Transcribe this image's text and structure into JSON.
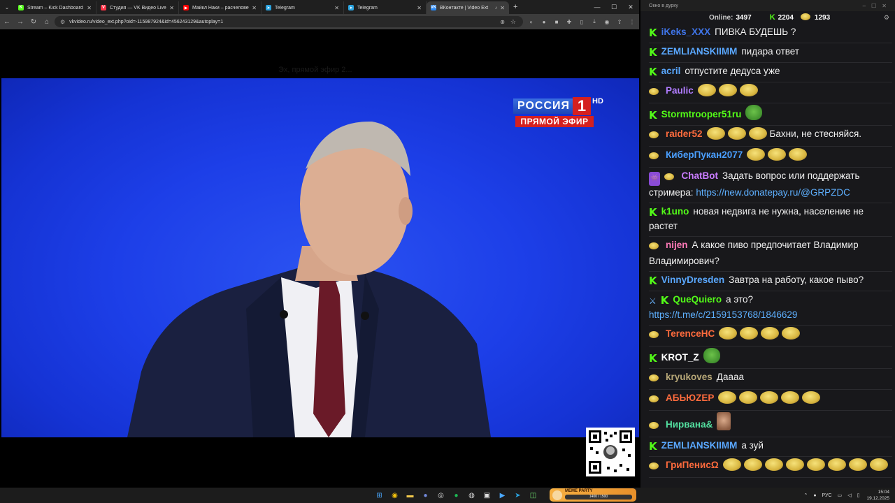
{
  "browser": {
    "tabs": [
      {
        "title": "Stream – Kick Dashboard",
        "favicon": "kick-icon",
        "color": "#53fc18",
        "glyph": "K"
      },
      {
        "title": "Студия — VK Видео Live",
        "favicon": "vk-live-icon",
        "color": "#ff3347",
        "glyph": "V"
      },
      {
        "title": "Майкл Наки – расчеловечива",
        "favicon": "youtube-icon",
        "color": "#ff0000",
        "glyph": "▶"
      },
      {
        "title": "Telegram",
        "favicon": "telegram-icon",
        "color": "#2aa3df",
        "glyph": "➤"
      },
      {
        "title": "Telegram",
        "favicon": "telegram-icon",
        "color": "#2aa3df",
        "glyph": "➤"
      },
      {
        "title": "ВКонтакте | Video Ext",
        "favicon": "vk-icon",
        "color": "#2787f5",
        "glyph": "VK"
      }
    ],
    "url": "vkvideo.ru/video_ext.php?oid=-115987924&id=456243129&autoplay=1"
  },
  "video": {
    "ghost_text": "Эх, прямой эфир 2...",
    "channel_name": "РОССИЯ",
    "channel_number": "1",
    "hd_label": "HD",
    "live_label": "ПРЯМОЙ ЭФИР"
  },
  "chat": {
    "window_title": "Окно в дурку",
    "online_label": "Online:",
    "online_count": "3497",
    "kick_viewers": "2204",
    "emote_count": "1293",
    "messages": [
      {
        "badge": "kick",
        "user": "iKeks_XXX",
        "color": "#3f74e8",
        "text": "ПИВКА БУДЕШЬ ?",
        "emotes": 0
      },
      {
        "badge": "kick",
        "user": "ZEMLIANSKIIMM",
        "color": "#5aa8ff",
        "text": "пидара ответ",
        "emotes": 0
      },
      {
        "badge": "kick",
        "user": "acril",
        "color": "#5aa8ff",
        "text": "отпустите дедуса уже",
        "emotes": 0
      },
      {
        "badge": "emote",
        "user": "Paulic",
        "color": "#b07cff",
        "text": "",
        "emotes": 3
      },
      {
        "badge": "kick",
        "user": "Stormtrooper51ru",
        "color": "#53fc18",
        "text": "",
        "emotes": 0,
        "special": "pepe"
      },
      {
        "badge": "emote",
        "user": "raider52",
        "color": "#ff6b3d",
        "text": "Бахни, не стесняйся.",
        "emotes": 3
      },
      {
        "badge": "emote",
        "user": "КиберПукан2077",
        "color": "#4a9fff",
        "text": "",
        "emotes": 3
      },
      {
        "badge": "bot",
        "user": "ChatBot",
        "color": "#c97cff",
        "text": "Задать вопрос или поддержать стримера:",
        "link": "https://new.donatepay.ru/@GRPZDC",
        "emotes": 0
      },
      {
        "badge": "kick",
        "user": "k1uno",
        "color": "#53fc18",
        "text": "новая недвига не нужна, население не растет",
        "emotes": 0
      },
      {
        "badge": "emote",
        "user": "nijen",
        "color": "#ff7ab8",
        "text": "А какое пиво предпочитает Владимир Владимирович?",
        "emotes": 0
      },
      {
        "badge": "kick",
        "user": "VinnyDresden",
        "color": "#5aa8ff",
        "text": "Завтра на работу, какое пыво?",
        "emotes": 0
      },
      {
        "badge": "sword",
        "user": "QueQuiero",
        "color": "#53fc18",
        "text": "а это?",
        "link": "https://t.me/c/2159153768/1846629",
        "emotes": 0
      },
      {
        "badge": "emote",
        "user": "TerenceHC",
        "color": "#ff6b3d",
        "text": "",
        "emotes": 4
      },
      {
        "badge": "kick",
        "user": "KROT_Z",
        "color": "#ffffff",
        "text": "",
        "emotes": 0,
        "special": "pepe"
      },
      {
        "badge": "emote",
        "user": "kryukoves",
        "color": "#b8a878",
        "text": "Даааа",
        "emotes": 0
      },
      {
        "badge": "emote",
        "user": "АБЬЮZЕР",
        "color": "#ff6b3d",
        "text": "",
        "emotes": 5
      },
      {
        "badge": "emote",
        "user": "Нирвана&",
        "color": "#53e0a0",
        "text": "",
        "emotes": 0,
        "special": "face"
      },
      {
        "badge": "kick",
        "user": "ZEMLIANSKIIMM",
        "color": "#5aa8ff",
        "text": "а зуй",
        "emotes": 0
      },
      {
        "badge": "emote",
        "user": "ГриПенисΩ",
        "color": "#ff6b3d",
        "text": "",
        "emotes": 8
      }
    ]
  },
  "taskbar": {
    "widget_title": "MEME PARTY",
    "widget_progress": "1400 / 1500",
    "widget_progress_value": 0.93,
    "language": "РУС",
    "time": "15:04",
    "date": "19.12.2025"
  }
}
